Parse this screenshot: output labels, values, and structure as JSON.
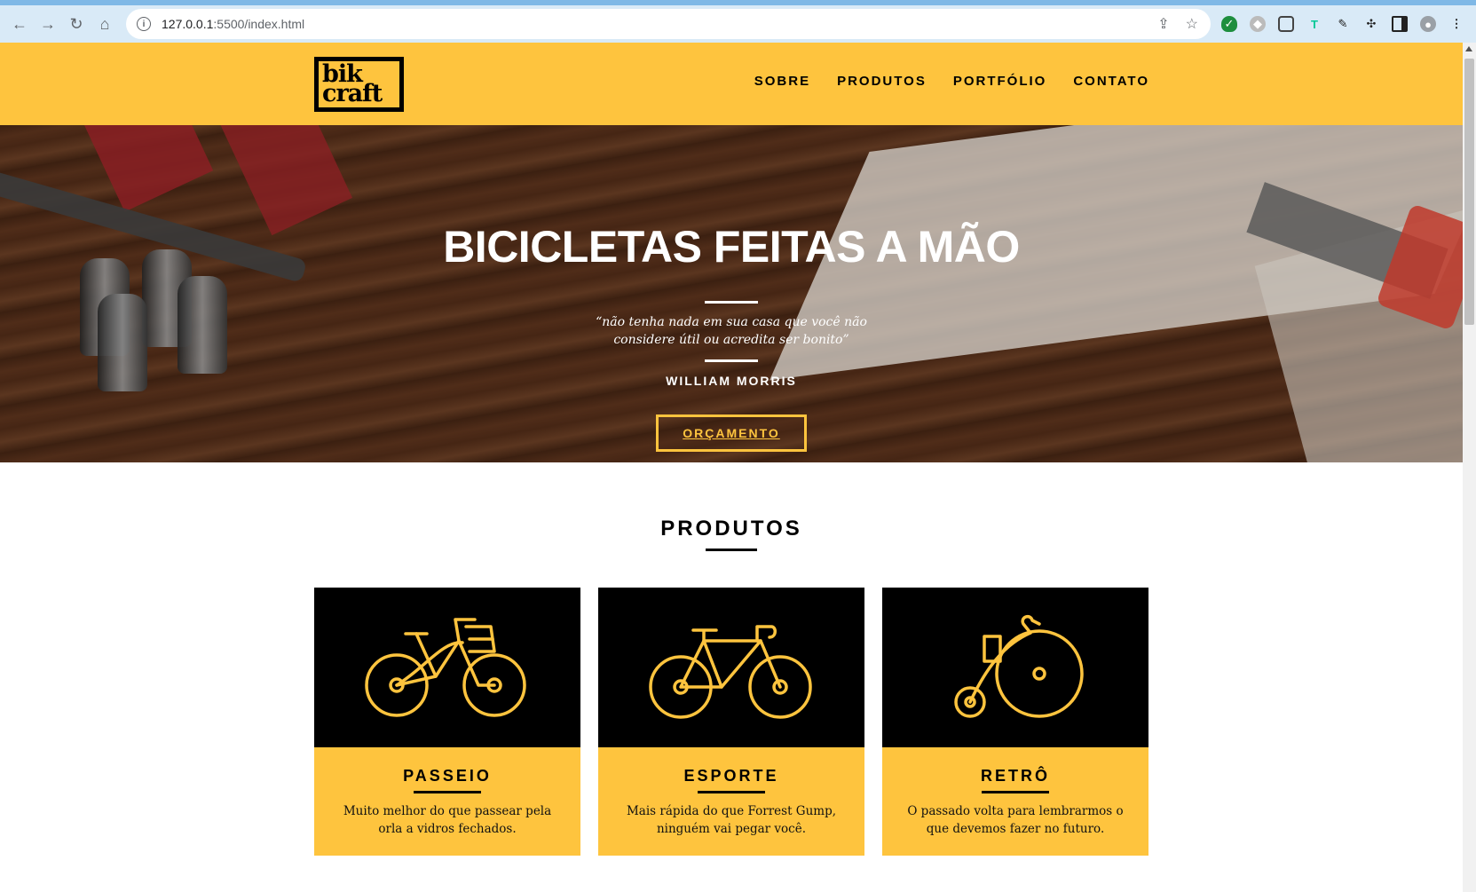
{
  "browser": {
    "url_host": "127.0.0.1",
    "url_path": ":5500/index.html"
  },
  "header": {
    "logo_line1": "bik",
    "logo_line2": "craft",
    "nav": [
      "SOBRE",
      "PRODUTOS",
      "PORTFÓLIO",
      "CONTATO"
    ]
  },
  "hero": {
    "title": "BICICLETAS FEITAS A MÃO",
    "quote": "“não tenha nada em sua casa que você não considere útil ou acredita ser bonito”",
    "author": "WILLIAM MORRIS",
    "cta": "ORÇAMENTO"
  },
  "produtos": {
    "title": "PRODUTOS",
    "items": [
      {
        "title": "PASSEIO",
        "text": "Muito melhor do que passear pela orla a vidros fechados.",
        "icon": "city-bike-icon"
      },
      {
        "title": "ESPORTE",
        "text": "Mais rápida do que Forrest Gump, ninguém vai pegar você.",
        "icon": "road-bike-icon"
      },
      {
        "title": "RETRÔ",
        "text": "O passado volta para lembrarmos o que devemos fazer no futuro.",
        "icon": "penny-farthing-icon"
      }
    ]
  },
  "colors": {
    "brand_yellow": "#fec43e",
    "black": "#000000",
    "white": "#ffffff"
  }
}
